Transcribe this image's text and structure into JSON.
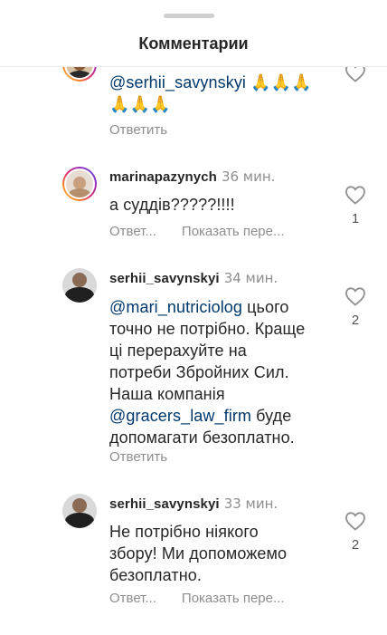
{
  "header": {
    "title": "Комментарии"
  },
  "comments": [
    {
      "username": "",
      "time": "",
      "mention": "@serhii_savynskyi",
      "text_line1_rest": " 🙏🙏🙏",
      "text_line2": "🙏🙏🙏",
      "reply_label": "Ответить",
      "likes": ""
    },
    {
      "username": "marinapazynych",
      "time": "36 мин.",
      "text": "а суддів?????!!!!",
      "reply_label": "Ответ...",
      "translate_label": "Показать пере...",
      "likes": "1"
    },
    {
      "username": "serhii_savynskyi",
      "time": "34 мин.",
      "mention1": "@mari_nutriciolog",
      "line1_rest": " цього",
      "line2": "точно не потрібно. Краще",
      "line3": "ці перерахуйте на",
      "line4": "потреби Збройних Сил.",
      "line5": "Наша компанія",
      "mention2": "@gracers_law_firm",
      "line6_rest": " буде",
      "line7": "допомагати безоплатно.",
      "reply_label": "Ответить",
      "likes": "2"
    },
    {
      "username": "serhii_savynskyi",
      "time": "33 мин.",
      "line1": "Не потрібно ніякого",
      "line2": "збору! Ми допоможемо",
      "line3": "безоплатно.",
      "reply_label": "Ответ...",
      "translate_label": "Показать пере...",
      "likes": "2"
    }
  ],
  "colors": {
    "text": "#262626",
    "secondary": "#8e8e8e",
    "mention": "#00376b"
  },
  "icons": [
    "heart-outline-icon"
  ]
}
